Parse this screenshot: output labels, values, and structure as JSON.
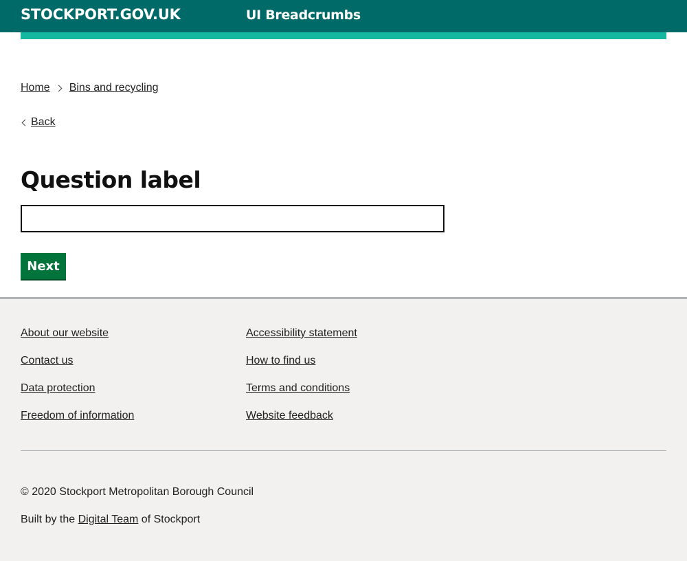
{
  "header": {
    "site_name": "STOCKPORT.GOV.UK",
    "service_name": "UI Breadcrumbs",
    "colors": {
      "header_bg": "#006a68",
      "accent_bar": "#14b8a0"
    }
  },
  "breadcrumb": {
    "items": [
      {
        "label": "Home"
      },
      {
        "label": "Bins and recycling"
      }
    ],
    "separator_icon": "chevron-right-icon"
  },
  "back": {
    "label": "Back",
    "icon": "chevron-left-icon"
  },
  "form": {
    "question_label": "Question label",
    "input_value": "",
    "input_placeholder": "",
    "next_label": "Next",
    "button_color": "#00743a"
  },
  "footer": {
    "column1": [
      {
        "label": "About our website"
      },
      {
        "label": "Contact us"
      },
      {
        "label": "Data protection"
      },
      {
        "label": "Freedom of information"
      }
    ],
    "column2": [
      {
        "label": "Accessibility statement"
      },
      {
        "label": "How to find us"
      },
      {
        "label": "Terms and conditions"
      },
      {
        "label": "Website feedback"
      }
    ],
    "copyright": "© 2020 Stockport Metropolitan Borough Council",
    "built_by_prefix": "Built by the ",
    "built_by_link": "Digital Team",
    "built_by_suffix": " of Stockport",
    "background": "#f2f1ef"
  }
}
